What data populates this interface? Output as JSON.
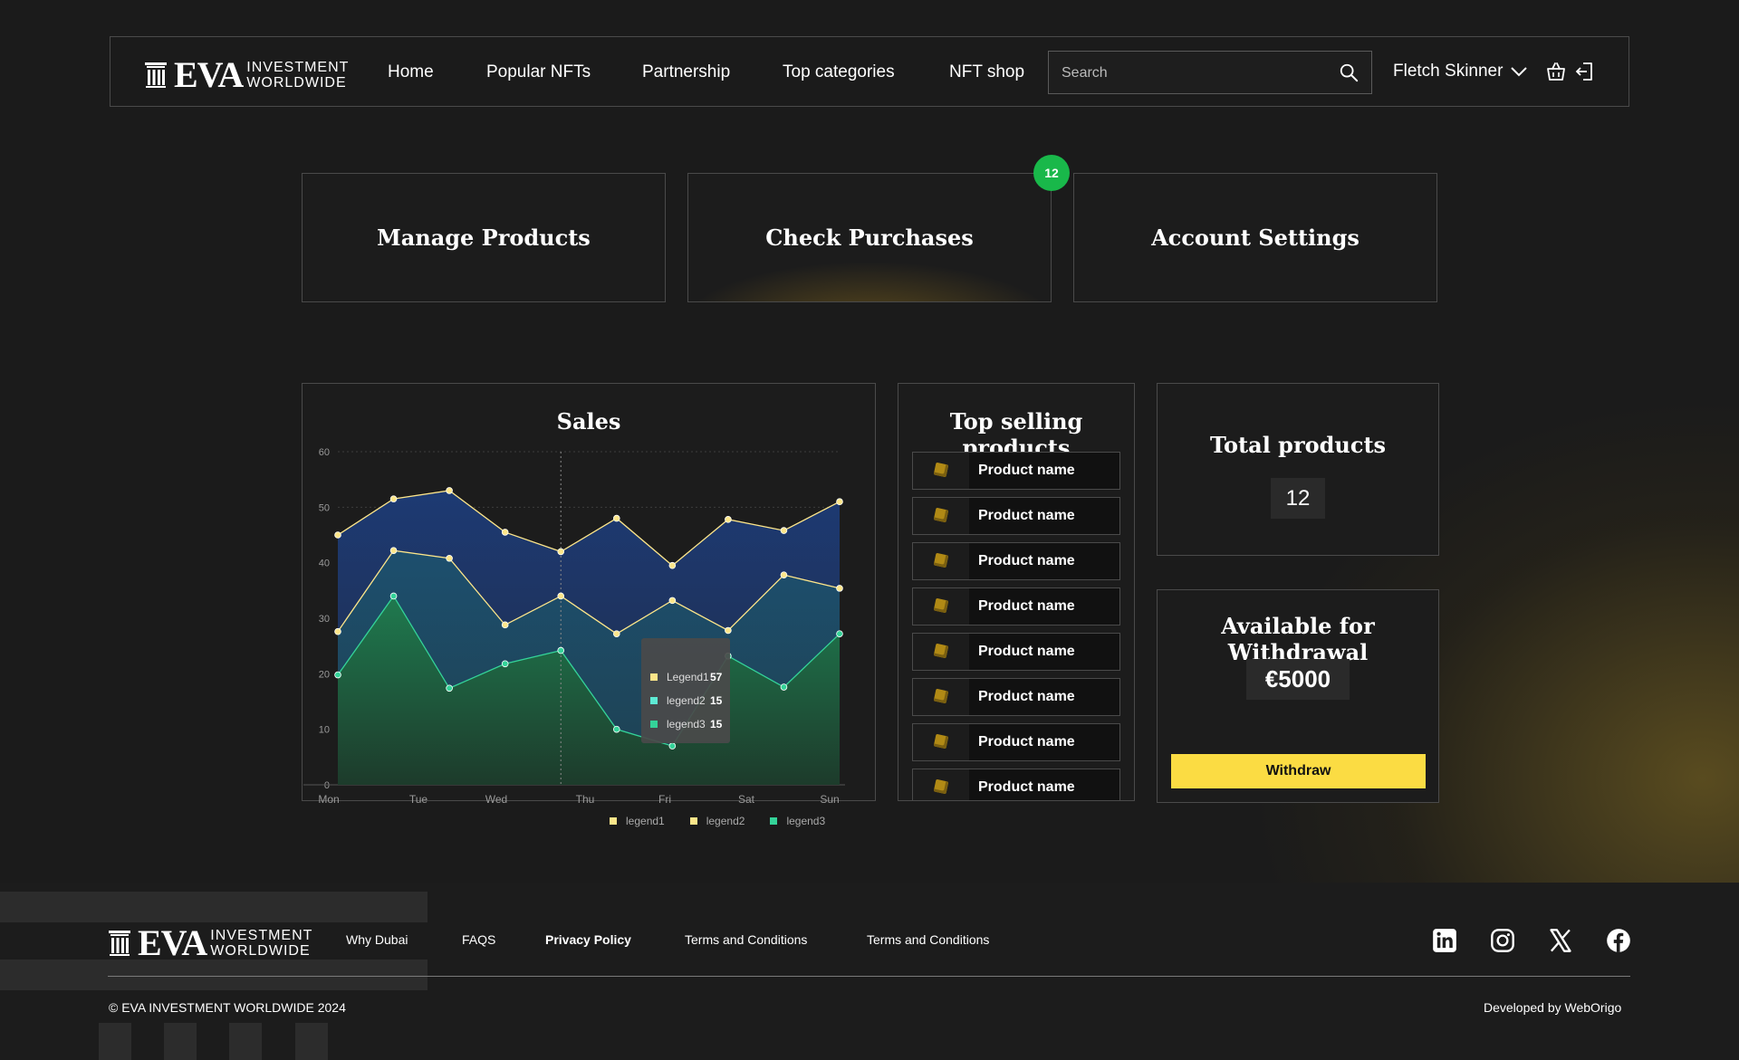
{
  "header": {
    "logo": {
      "name": "EVA",
      "line1": "INVESTMENT",
      "line2": "WORLDWIDE"
    },
    "nav": [
      "Home",
      "Popular NFTs",
      "Partnership",
      "Top categories",
      "NFT shop"
    ],
    "search_placeholder": "Search",
    "user_name": "Fletch Skinner"
  },
  "actions": {
    "manage": "Manage Products",
    "purchases": "Check Purchases",
    "purchases_badge": "12",
    "settings": "Account Settings"
  },
  "sales": {
    "title": "Sales"
  },
  "chart_data": {
    "type": "area",
    "title": "Sales",
    "categories": [
      "Mon",
      "Tue",
      "Wed",
      "Thu",
      "Fri",
      "Sat",
      "Sun"
    ],
    "x": [
      0,
      0.5,
      1,
      1.5,
      2,
      2.5,
      3,
      3.5,
      4,
      4.5,
      5,
      5.5,
      6
    ],
    "yticks": [
      0,
      10,
      20,
      30,
      40,
      50,
      60
    ],
    "ylim": [
      0,
      60
    ],
    "series": [
      {
        "name": "legend1",
        "color": "#fde68a",
        "values": [
          45,
          51.5,
          53,
          45.5,
          42,
          48,
          39.5,
          47.8,
          45.8,
          51
        ]
      },
      {
        "name": "legend2",
        "color": "#fde68a",
        "values": [
          27.6,
          42.2,
          40.8,
          28.8,
          34,
          27.2,
          33.2,
          27.8,
          37.8,
          35.4
        ]
      },
      {
        "name": "legend3",
        "color": "#34d399",
        "values": [
          19.8,
          34,
          17.4,
          21.8,
          24.2,
          10,
          7,
          23.2,
          17.6,
          27.2
        ]
      }
    ],
    "tooltip": [
      {
        "label": "Legend1",
        "value": "57",
        "color": "#fde68a"
      },
      {
        "label": "legend2",
        "value": "15",
        "color": "#5eead4"
      },
      {
        "label": "legend3",
        "value": "15",
        "color": "#34d399"
      }
    ],
    "legend": [
      {
        "label": "legend1",
        "color": "#fde68a"
      },
      {
        "label": "legend2",
        "color": "#fde68a"
      },
      {
        "label": "legend3",
        "color": "#34d399"
      }
    ],
    "legend_position": "bottom",
    "grid": true
  },
  "top_selling": {
    "title": "Top selling products",
    "items": [
      "Product name",
      "Product name",
      "Product name",
      "Product name",
      "Product name",
      "Product name",
      "Product name",
      "Product name"
    ]
  },
  "total_products": {
    "title": "Total products",
    "value": "12"
  },
  "withdrawal": {
    "title": "Available for Withdrawal",
    "amount": "€5000",
    "button": "Withdraw"
  },
  "footer": {
    "links": [
      "Why Dubai",
      "FAQS",
      "Privacy Policy",
      "Terms and Conditions",
      "Terms and Conditions"
    ],
    "copyright": "© EVA INVESTMENT WORLDWIDE 2024",
    "developer": "Developed by WebOrigo",
    "social": [
      "linkedin-icon",
      "instagram-icon",
      "x-icon",
      "facebook-icon"
    ]
  },
  "colors": {
    "accent": "#fbdc43",
    "badge": "#19b84a",
    "border": "#4a4a4a"
  }
}
